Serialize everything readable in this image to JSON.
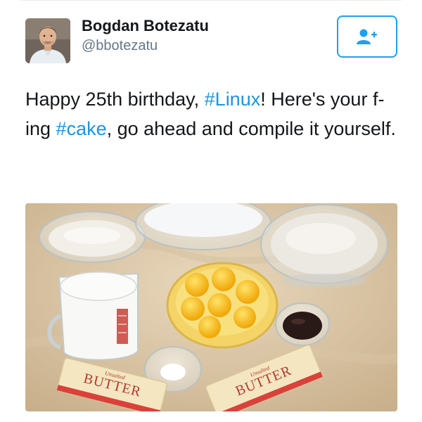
{
  "user": {
    "name": "Bogdan Botezatu",
    "handle": "@bbotezatu"
  },
  "follow_button": {
    "icon": "add-user-icon"
  },
  "tweet": {
    "text_1": "Happy 25th birthday, ",
    "hashtag_1": "#Linux",
    "text_2": "! Here's your f-ing ",
    "hashtag_2": "#cake",
    "text_3": ", go ahead and compile it yourself."
  },
  "image": {
    "butter_label_left": "BUTTER",
    "butter_label_right": "BUTTER",
    "butter_sublabel": "Unsalted"
  },
  "colors": {
    "link": "#1b95e0",
    "accent": "#1da1f2",
    "name": "#14171a",
    "handle": "#657786"
  }
}
